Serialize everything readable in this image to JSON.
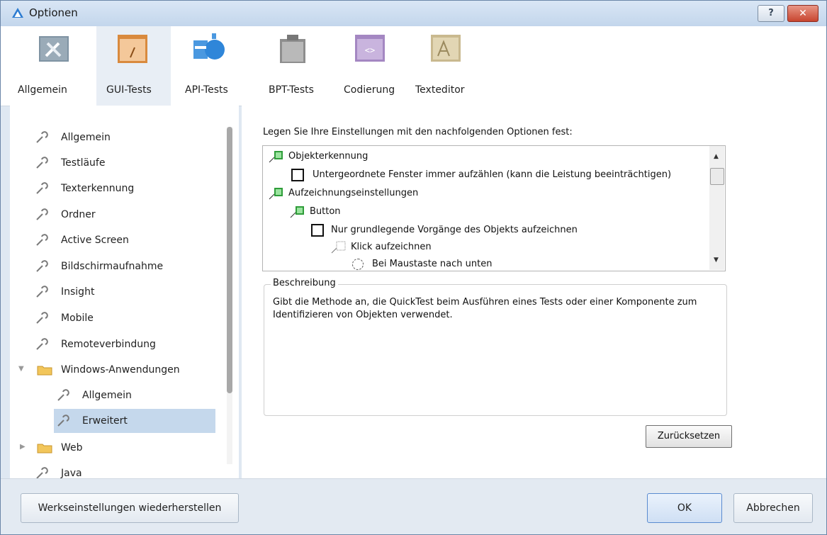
{
  "window": {
    "title": "Optionen",
    "help_label": "?",
    "close_label": "✕"
  },
  "toolbar": {
    "items": [
      {
        "label": "Allgemein",
        "icon": "tools-icon"
      },
      {
        "label": "GUI-Tests",
        "icon": "gui-tests-icon",
        "active": true
      },
      {
        "label": "API-Tests",
        "icon": "api-tests-icon"
      },
      {
        "label": "BPT-Tests",
        "icon": "bpt-tests-icon"
      },
      {
        "label": "Codierung",
        "icon": "code-icon"
      },
      {
        "label": "Texteditor",
        "icon": "text-editor-icon"
      }
    ]
  },
  "sidebar": {
    "items": [
      {
        "label": "Allgemein",
        "icon": "wrench-icon"
      },
      {
        "label": "Testläufe",
        "icon": "wrench-icon"
      },
      {
        "label": "Texterkennung",
        "icon": "wrench-icon"
      },
      {
        "label": "Ordner",
        "icon": "wrench-icon"
      },
      {
        "label": "Active Screen",
        "icon": "wrench-icon"
      },
      {
        "label": "Bildschirmaufnahme",
        "icon": "wrench-icon"
      },
      {
        "label": "Insight",
        "icon": "wrench-icon"
      },
      {
        "label": "Mobile",
        "icon": "wrench-icon"
      },
      {
        "label": "Remoteverbindung",
        "icon": "wrench-icon"
      },
      {
        "label": "Windows-Anwendungen",
        "icon": "folder-icon",
        "expanded": true
      },
      {
        "label": "Allgemein",
        "icon": "wrench-icon"
      },
      {
        "label": "Erweitert",
        "icon": "wrench-icon",
        "selected": true
      },
      {
        "label": "Web",
        "icon": "folder-icon",
        "expanded": false
      },
      {
        "label": "Java",
        "icon": "wrench-icon"
      }
    ]
  },
  "main": {
    "intro": "Legen Sie Ihre Einstellungen mit den nachfolgenden Optionen fest:",
    "options": [
      {
        "label": "Objekterkennung",
        "kind": "group"
      },
      {
        "label": "Untergeordnete Fenster immer aufzählen (kann die Leistung beeinträchtigen)",
        "kind": "checkbox",
        "checked": false
      },
      {
        "label": "Aufzeichnungseinstellungen",
        "kind": "group"
      },
      {
        "label": "Button",
        "kind": "group"
      },
      {
        "label": "Nur grundlegende Vorgänge des Objekts aufzeichnen",
        "kind": "checkbox",
        "checked": false
      },
      {
        "label": "Klick aufzeichnen",
        "kind": "subgroup"
      },
      {
        "label": "Bei Maustaste nach unten",
        "kind": "radio",
        "selected": false
      }
    ],
    "description_legend": "Beschreibung",
    "description_text": "Gibt die Methode an, die QuickTest beim Ausführen eines Tests oder einer Komponente zum Identifizieren von Objekten verwendet.",
    "reset_label": "Zurücksetzen"
  },
  "footer": {
    "restore_label": "Werkseinstellungen wiederherstellen",
    "ok_label": "OK",
    "cancel_label": "Abbrechen"
  }
}
